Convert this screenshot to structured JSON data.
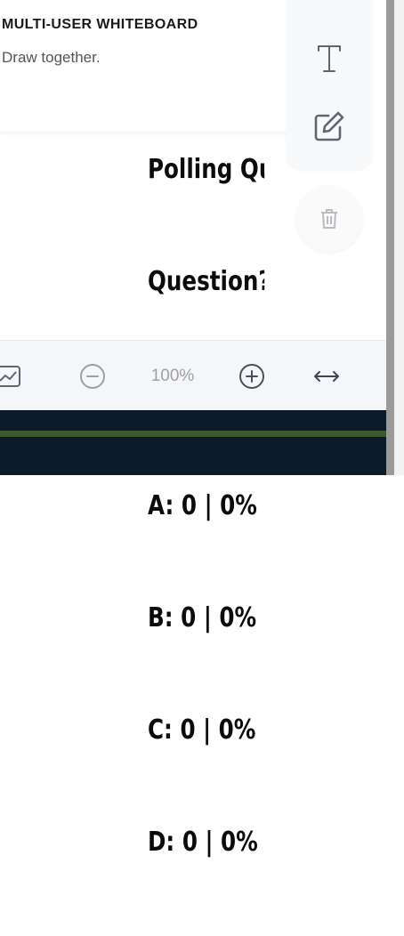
{
  "app": {
    "title": "MULTI-USER WHITEBOARD",
    "subtitle": "Draw together."
  },
  "poll": {
    "lines": [
      "Polling Ques",
      "Question?",
      "",
      "A: 0 | 0%",
      "B: 0 | 0%",
      "C: 0 | 0%",
      "D: 0 | 0%"
    ]
  },
  "toolbar": {
    "tools": [
      {
        "name": "text-tool",
        "icon": "text-T-icon"
      },
      {
        "name": "note-tool",
        "icon": "pencil-square-icon"
      },
      {
        "name": "delete-tool",
        "icon": "trash-icon"
      }
    ]
  },
  "zoom": {
    "level": "100%",
    "icons": [
      "chart-line-icon",
      "minus-circle-icon",
      "plus-circle-icon",
      "fit-width-arrows-icon"
    ]
  },
  "colors": {
    "footer": "#0d1a2b",
    "accent_line": "#3d5a2e",
    "icon": "#5f6670"
  }
}
